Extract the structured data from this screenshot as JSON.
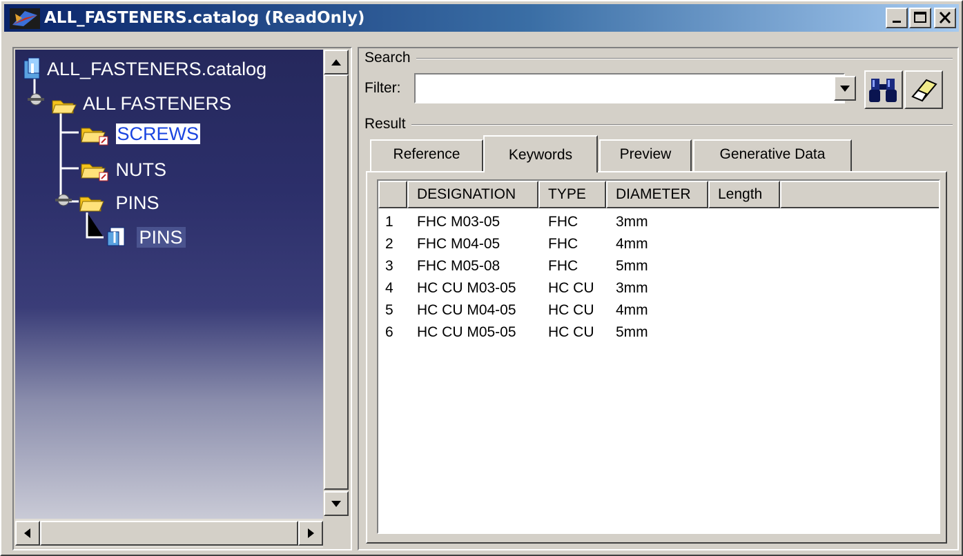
{
  "window": {
    "title": "ALL_FASTENERS.catalog (ReadOnly)"
  },
  "tree": {
    "root": "ALL_FASTENERS.catalog",
    "chapter": "ALL FASTENERS",
    "items": [
      {
        "label": "SCREWS",
        "selected": true
      },
      {
        "label": "NUTS",
        "selected": false
      },
      {
        "label": "PINS",
        "selected": false
      }
    ],
    "leaf": "PINS"
  },
  "search": {
    "group_label": "Search",
    "filter_label": "Filter:",
    "filter_value": ""
  },
  "result": {
    "group_label": "Result",
    "tabs": [
      {
        "label": "Reference",
        "active": false
      },
      {
        "label": "Keywords",
        "active": true
      },
      {
        "label": "Preview",
        "active": false
      },
      {
        "label": "Generative Data",
        "active": false
      }
    ],
    "columns": [
      "DESIGNATION",
      "TYPE",
      "DIAMETER",
      "Length"
    ],
    "rows": [
      {
        "num": "1",
        "designation": "FHC M03-05",
        "type": "FHC",
        "diameter": "3mm"
      },
      {
        "num": "2",
        "designation": "FHC M04-05",
        "type": "FHC",
        "diameter": "4mm"
      },
      {
        "num": "3",
        "designation": "FHC M05-08",
        "type": "FHC",
        "diameter": "5mm"
      },
      {
        "num": "4",
        "designation": "HC CU M03-05",
        "type": "HC CU",
        "diameter": "3mm"
      },
      {
        "num": "5",
        "designation": "HC CU M04-05",
        "type": "HC CU",
        "diameter": "4mm"
      },
      {
        "num": "6",
        "designation": "HC CU M05-05",
        "type": "HC CU",
        "diameter": "5mm"
      }
    ]
  },
  "colors": {
    "title_start": "#0a246a",
    "title_end": "#a6caf0",
    "selection_text": "#1a44e0",
    "face": "#d4d0c8"
  },
  "icons": [
    "catia-app-icon",
    "minimize-icon",
    "maximize-icon",
    "close-icon",
    "catalog-icon",
    "folder-icon",
    "chapter-link-icon",
    "document-icon",
    "binoculars-icon",
    "eraser-icon",
    "scroll-up-icon",
    "scroll-down-icon",
    "scroll-left-icon",
    "scroll-right-icon",
    "dropdown-arrow-icon"
  ]
}
